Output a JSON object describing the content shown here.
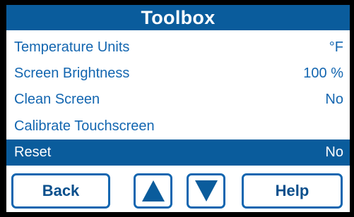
{
  "title": "Toolbox",
  "menu": [
    {
      "label": "Temperature Units",
      "value": "°F"
    },
    {
      "label": "Screen Brightness",
      "value": "100 %"
    },
    {
      "label": "Clean Screen",
      "value": "No"
    },
    {
      "label": "Calibrate Touchscreen",
      "value": ""
    },
    {
      "label": "Reset",
      "value": "No",
      "selected": true
    }
  ],
  "buttons": {
    "back": "Back",
    "up_icon": "triangle-up-icon",
    "down_icon": "triangle-down-icon",
    "help": "Help"
  },
  "colors": {
    "accent": "#0a5c9c",
    "text": "#1366b0",
    "background": "#000000",
    "panel": "#ffffff"
  }
}
